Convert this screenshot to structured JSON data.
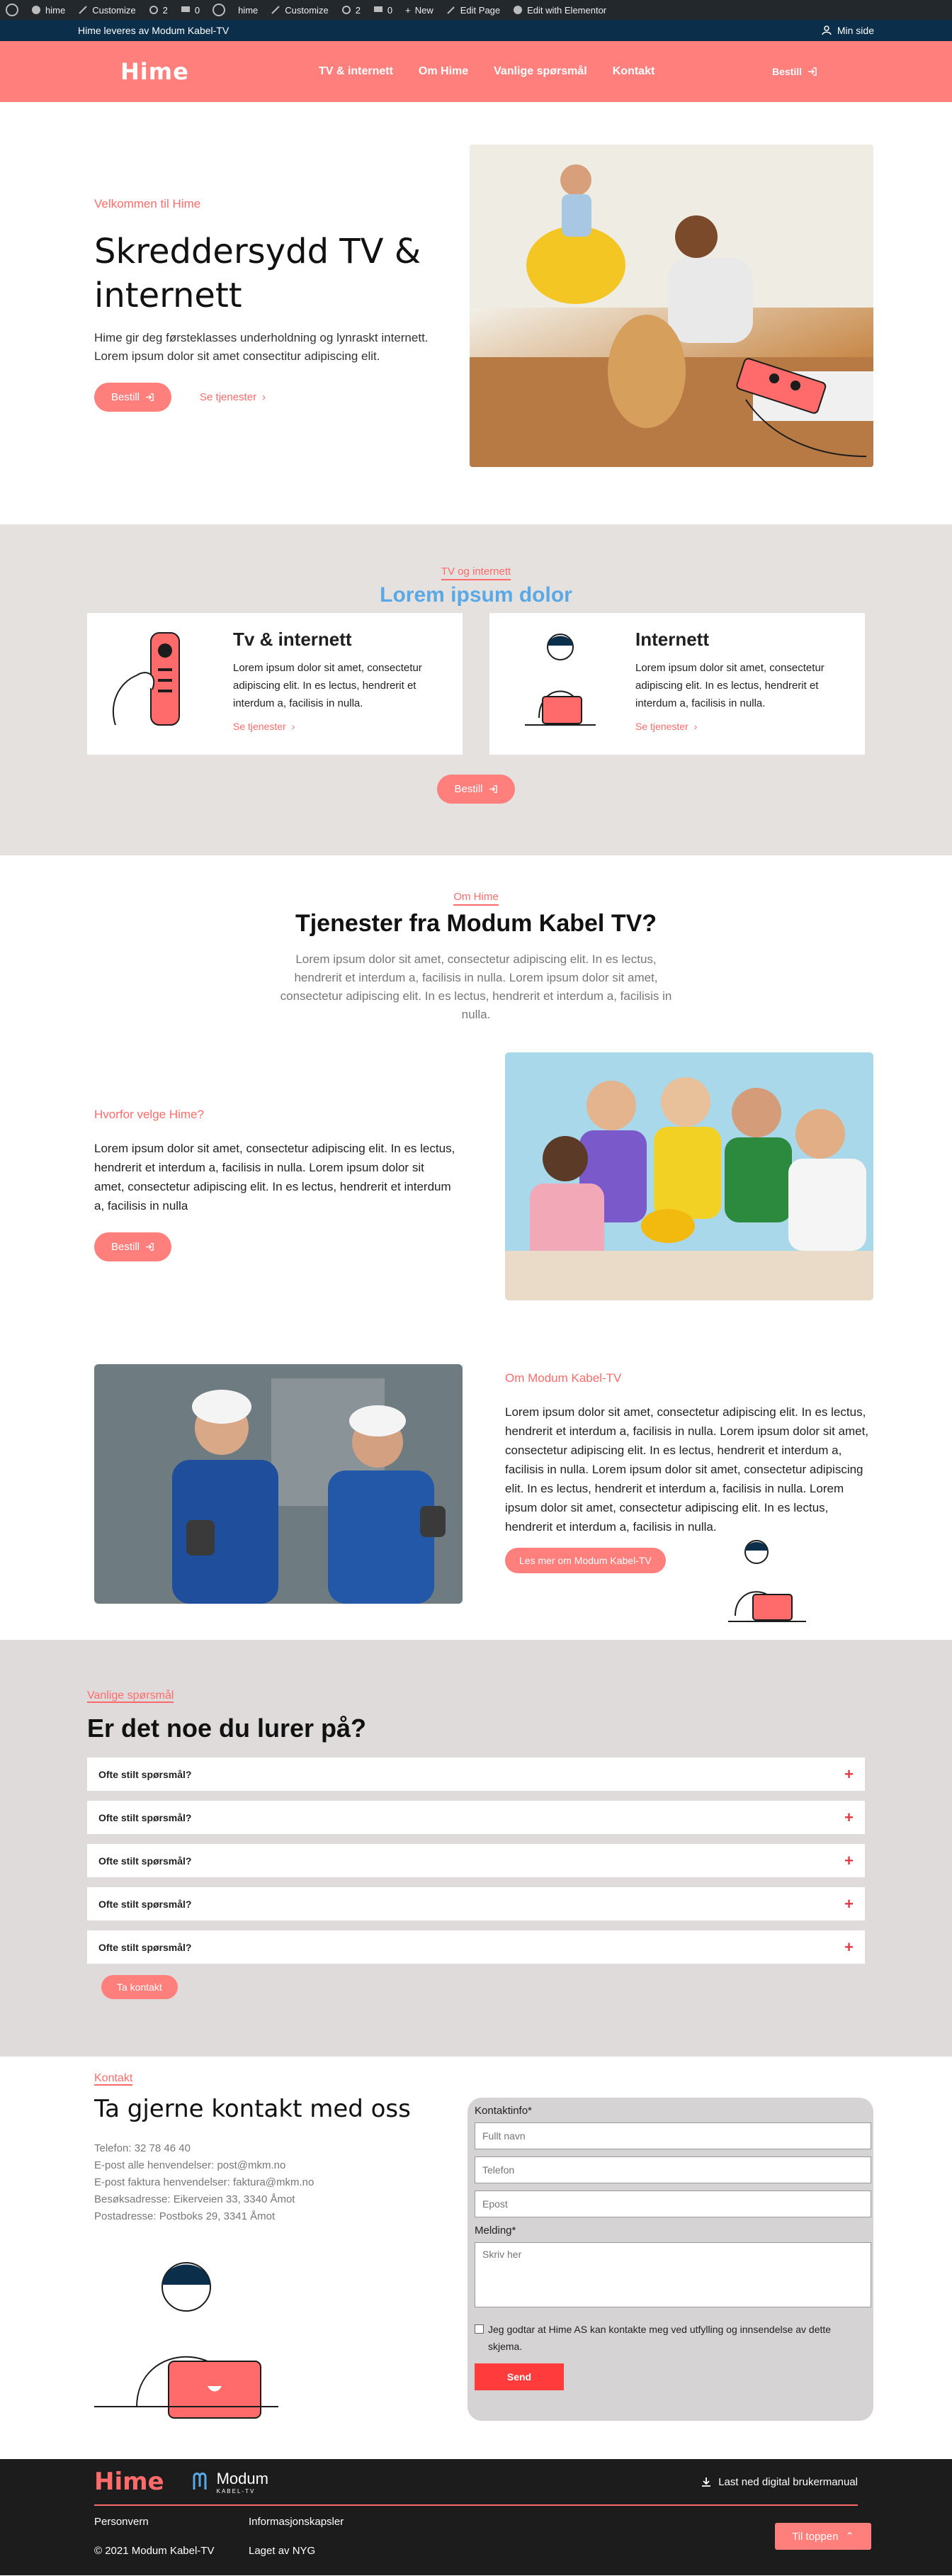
{
  "adminbar": {
    "items": [
      "hime",
      "Customize",
      "2",
      "0",
      "hime",
      "Customize",
      "2",
      "0",
      "New",
      "Edit Page",
      "Edit with Elementor"
    ]
  },
  "notice": {
    "text": "Hime leveres av Modum Kabel-TV",
    "login": "Min side"
  },
  "header": {
    "logo": "Hime",
    "nav": [
      "TV & internett",
      "Om Hime",
      "Vanlige spørsmål",
      "Kontakt"
    ],
    "order": "Bestill"
  },
  "hero": {
    "eyebrow": "Velkommen til Hime",
    "title": "Skreddersydd TV & internett",
    "text": "Hime gir deg førsteklasses underholdning og lynraskt internett. Lorem ipsum dolor sit amet consectitur adipiscing elit.",
    "cta": "Bestill",
    "link": "Se tjenester"
  },
  "tv": {
    "eyebrow": "TV og internett",
    "title": "Lorem ipsum dolor",
    "cards": [
      {
        "title": "Tv & internett",
        "text": "Lorem ipsum dolor sit amet, consectetur adipiscing elit. In es lectus, hendrerit et interdum a, facilisis in nulla.",
        "link": "Se tjenester"
      },
      {
        "title": "Internett",
        "text": "Lorem ipsum dolor sit amet, consectetur adipiscing elit. In es lectus, hendrerit et interdum a, facilisis in nulla.",
        "link": "Se tjenester"
      }
    ],
    "cta": "Bestill"
  },
  "services": {
    "eyebrow": "Om Hime",
    "title": "Tjenester fra Modum Kabel TV?",
    "lead": "Lorem ipsum dolor sit amet, consectetur adipiscing elit. In es lectus, hendrerit et interdum a, facilisis in nulla. Lorem ipsum dolor sit amet, consectetur adipiscing elit. In es lectus, hendrerit et interdum a, facilisis in nulla.",
    "why": {
      "eyebrow": "Hvorfor velge Hime?",
      "text": "Lorem ipsum dolor sit amet, consectetur adipiscing elit. In es lectus, hendrerit et interdum a, facilisis in nulla. Lorem ipsum dolor sit amet, consectetur adipiscing elit. In es lectus, hendrerit et interdum a, facilisis in nulla",
      "cta": "Bestill"
    },
    "about": {
      "eyebrow": "Om Modum Kabel-TV",
      "text": "Lorem ipsum dolor sit amet, consectetur adipiscing elit. In es lectus, hendrerit et interdum a, facilisis in nulla. Lorem ipsum dolor sit amet, consectetur adipiscing elit. In es lectus, hendrerit et interdum a, facilisis in nulla. Lorem ipsum dolor sit amet, consectetur adipiscing elit. In es lectus, hendrerit et interdum a, facilisis in nulla. Lorem ipsum dolor sit amet, consectetur adipiscing elit. In es lectus, hendrerit et interdum a, facilisis in nulla.",
      "cta": "Les mer om Modum Kabel-TV"
    }
  },
  "faq": {
    "eyebrow": "Vanlige spørsmål",
    "title": "Er det noe du lurer på?",
    "items": [
      "Ofte stilt spørsmål?",
      "Ofte stilt spørsmål?",
      "Ofte stilt spørsmål?",
      "Ofte stilt spørsmål?",
      "Ofte stilt spørsmål?"
    ],
    "cta": "Ta kontakt"
  },
  "contact": {
    "eyebrow": "Kontakt",
    "title": "Ta gjerne kontakt med oss",
    "info": [
      "Telefon: 32 78 46 40",
      "E-post alle henvendelser: post@mkm.no",
      "E-post faktura henvendelser: faktura@mkm.no",
      "Besøksadresse: Eikerveien 33, 3340 Åmot",
      "Postadresse: Postboks 29, 3341 Åmot"
    ],
    "form": {
      "contact_label": "Kontaktinfo*",
      "name_ph": "Fullt navn",
      "phone_ph": "Telefon",
      "email_ph": "Epost",
      "message_label": "Melding*",
      "message_ph": "Skriv her",
      "consent": "Jeg godtar at Hime AS kan kontakte meg ved utfylling og innsendelse av dette skjema.",
      "send": "Send"
    }
  },
  "footer": {
    "logo": "Hime",
    "partner": "Modum",
    "partner_sub": "KABEL-TV",
    "download": "Last ned digital brukermanual",
    "col1": [
      "Personvern",
      "© 2021 Modum Kabel-TV"
    ],
    "col2": [
      "Informasjonskapsler",
      "Laget av NYG"
    ],
    "totop": "Til toppen"
  },
  "colors": {
    "coral": "#ff7f7d",
    "navy": "#0b2f4a",
    "blue": "#5aa9e6",
    "red": "#ff3b3b",
    "footer": "#1c1c1c"
  }
}
